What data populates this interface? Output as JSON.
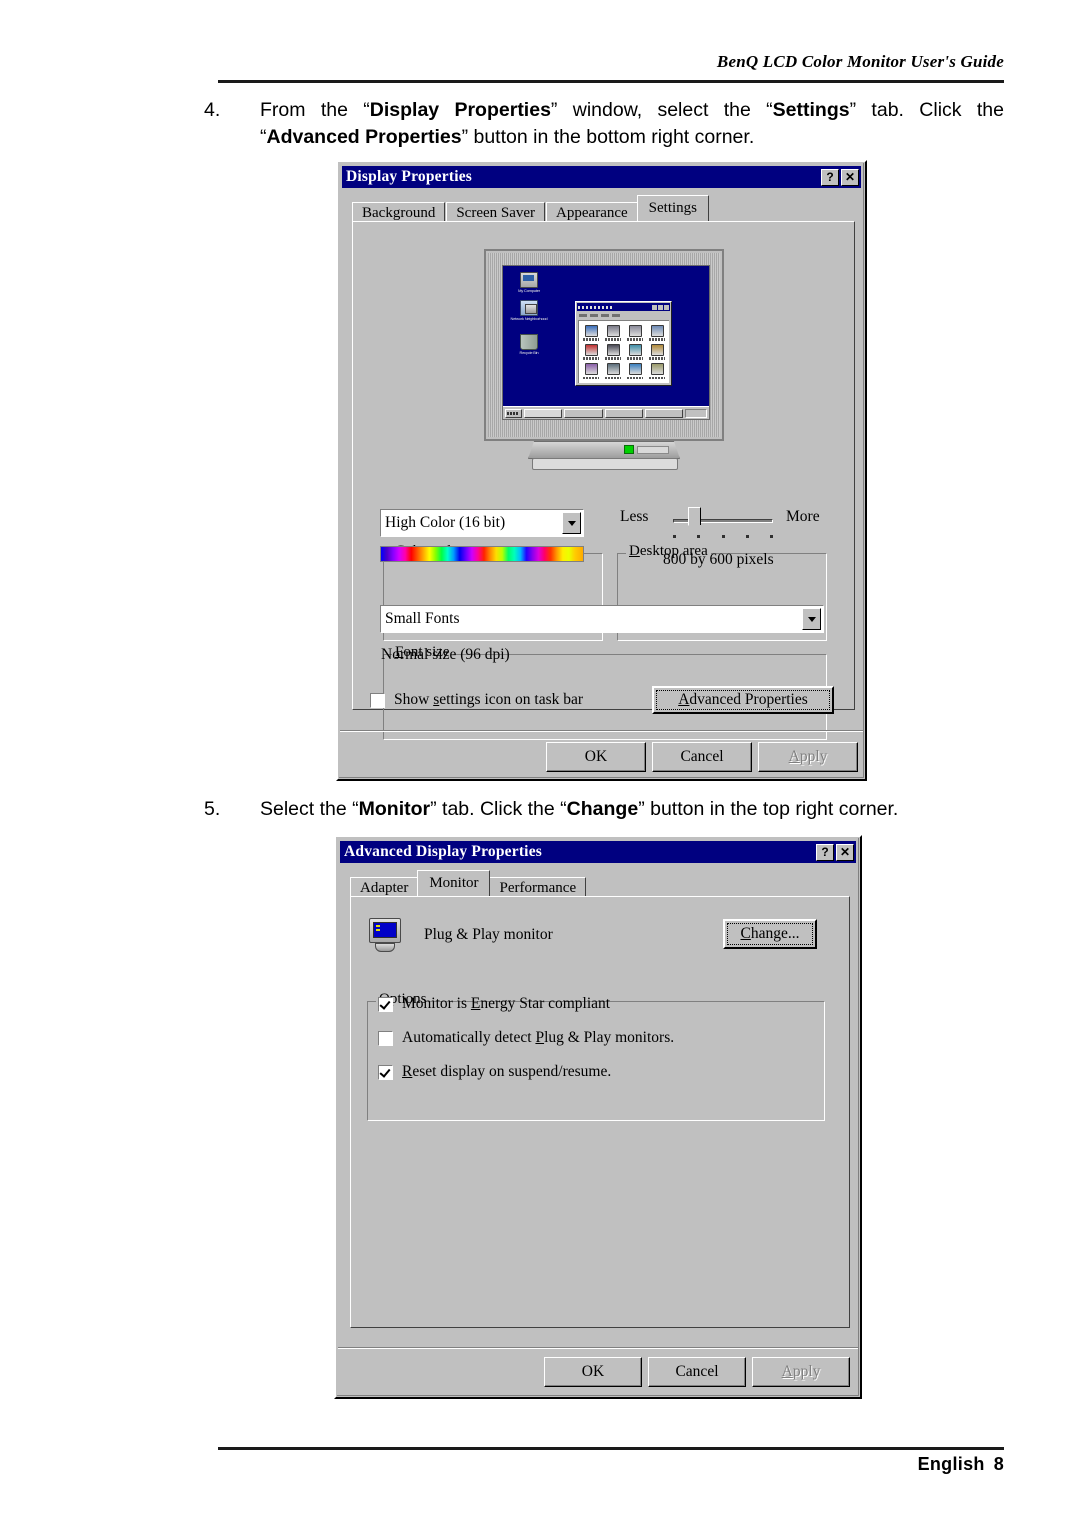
{
  "page": {
    "header_title": "BenQ LCD Color Monitor User's Guide",
    "footer_language": "English",
    "footer_page": "8"
  },
  "steps": [
    {
      "number": "4.",
      "parts": [
        {
          "t": "From the “",
          "b": false
        },
        {
          "t": "Display Properties",
          "b": true
        },
        {
          "t": "” window, select the “",
          "b": false
        },
        {
          "t": "Settings",
          "b": true
        },
        {
          "t": "” tab. Click the “",
          "b": false
        },
        {
          "t": "Advanced Properties",
          "b": true
        },
        {
          "t": "” button in the bottom right corner.",
          "b": false
        }
      ]
    },
    {
      "number": "5.",
      "parts": [
        {
          "t": "Select the “",
          "b": false
        },
        {
          "t": "Monitor",
          "b": true
        },
        {
          "t": "” tab. Click the “",
          "b": false
        },
        {
          "t": "Change",
          "b": true
        },
        {
          "t": "” button in the top right corner.",
          "b": false
        }
      ]
    }
  ],
  "display_properties": {
    "title": "Display Properties",
    "help_button": "?",
    "close_button": "✕",
    "tabs": [
      {
        "label": "Background",
        "active": false
      },
      {
        "label": "Screen Saver",
        "active": false
      },
      {
        "label": "Appearance",
        "active": false
      },
      {
        "label": "Settings",
        "active": true
      }
    ],
    "color_palette": {
      "legend_accel": "C",
      "legend_rest": "olor palette",
      "selected": "High Color (16 bit)"
    },
    "desktop_area": {
      "legend_accel": "D",
      "legend_rest": "esktop area",
      "less_label": "Less",
      "more_label": "More",
      "resolution": "800 by 600 pixels",
      "tick_count": 5
    },
    "font_size": {
      "legend_accel": "F",
      "legend_rest": "ont size",
      "selected": "Small Fonts",
      "note": "Normal size (96 dpi)"
    },
    "show_settings_checkbox": {
      "pre": "Show ",
      "accel": "s",
      "post": "ettings icon on task bar",
      "checked": false
    },
    "advanced_button": {
      "accel": "A",
      "rest": "dvanced Properties"
    },
    "buttons": [
      {
        "label": "OK",
        "disabled": false
      },
      {
        "label": "Cancel",
        "disabled": false
      },
      {
        "label": "Apply",
        "disabled": true,
        "accel": "A",
        "rest": "pply"
      }
    ],
    "preview": {
      "desktop_icons": [
        {
          "name": "My Computer",
          "glyph": "g-comp"
        },
        {
          "name": "Network Neighborhood",
          "glyph": "g-net"
        },
        {
          "name": "Recycle Bin",
          "glyph": "g-bin"
        }
      ],
      "inner_window_icon_rows": 3,
      "inner_window_icon_cols": 4,
      "taskbar_task_count": 4,
      "led_color": "#00d000",
      "screen_background": "#000080"
    }
  },
  "advanced_display_properties": {
    "title": "Advanced Display Properties",
    "help_button": "?",
    "close_button": "✕",
    "tabs": [
      {
        "label": "Adapter",
        "active": false
      },
      {
        "label": "Monitor",
        "active": true
      },
      {
        "label": "Performance",
        "active": false
      }
    ],
    "monitor_name": "Plug & Play monitor",
    "change_button": {
      "accel": "C",
      "rest": "hange..."
    },
    "options": {
      "legend": "Options",
      "items": [
        {
          "pre": "Monitor is ",
          "accel": "E",
          "post": "nergy Star compliant",
          "checked": true
        },
        {
          "pre": "Automatically detect ",
          "accel": "P",
          "post": "lug & Play monitors.",
          "checked": false
        },
        {
          "pre": "",
          "accel": "R",
          "post": "eset display on suspend/resume.",
          "checked": true
        }
      ]
    },
    "buttons": [
      {
        "label": "OK",
        "disabled": false
      },
      {
        "label": "Cancel",
        "disabled": false
      },
      {
        "label": "Apply",
        "disabled": true,
        "accel": "A",
        "rest": "pply"
      }
    ]
  }
}
